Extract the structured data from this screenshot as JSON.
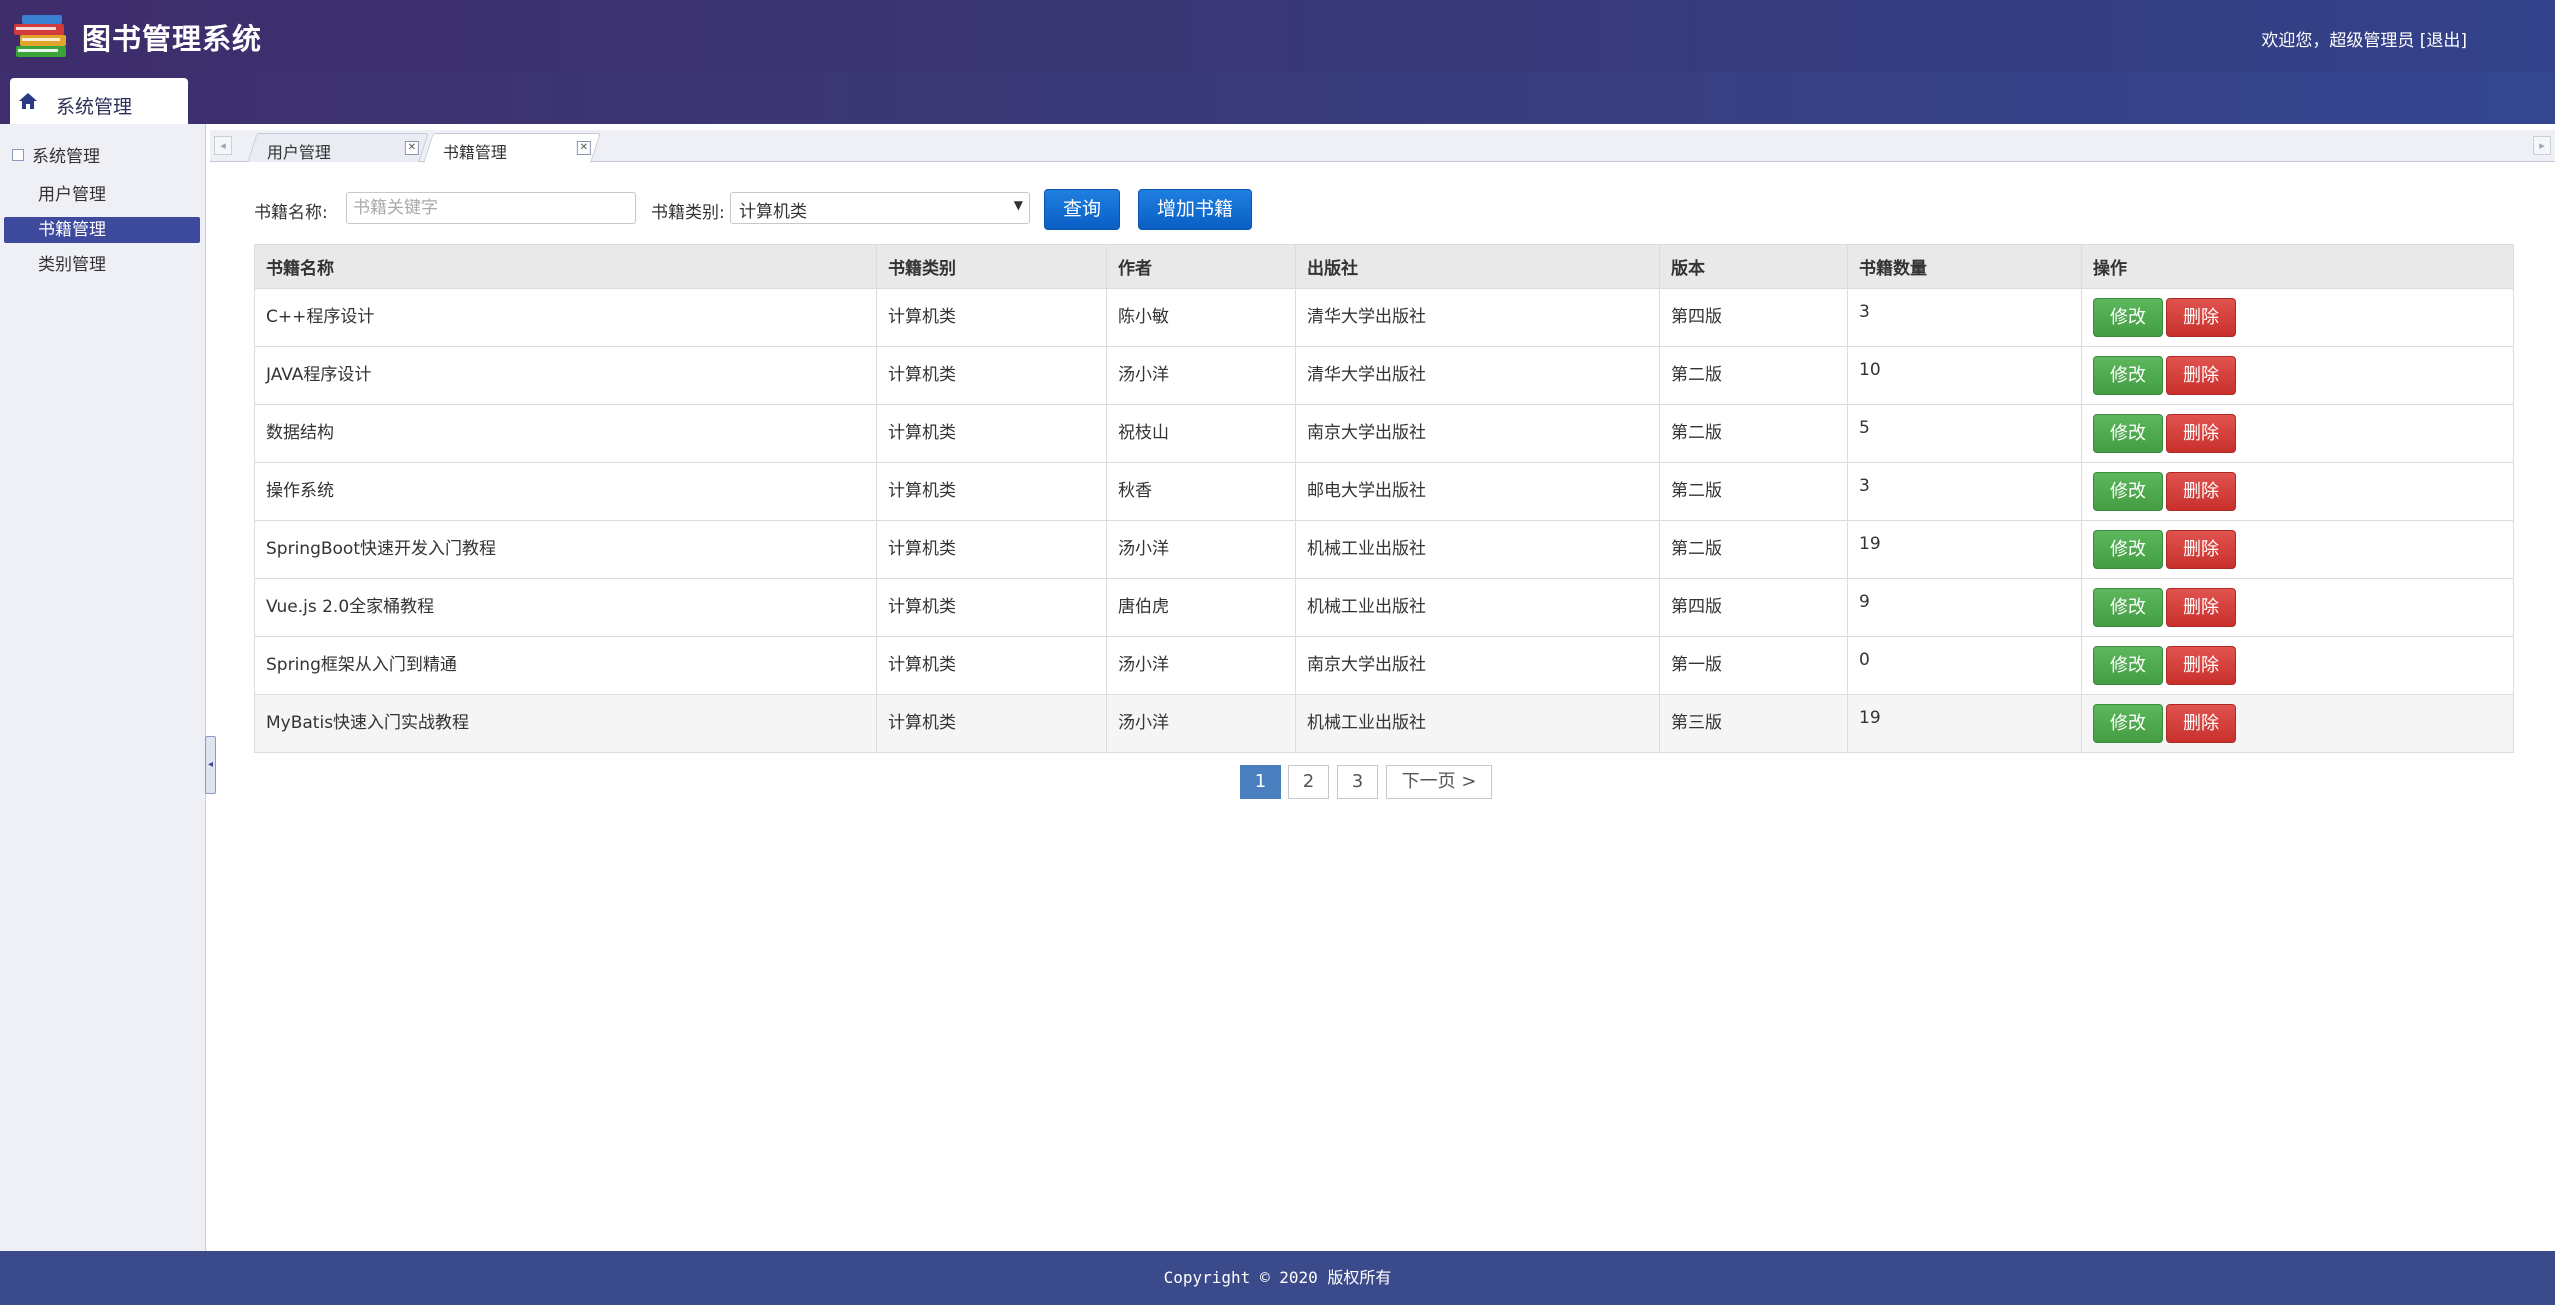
{
  "header": {
    "app_title": "图书管理系统",
    "welcome_text": "欢迎您，超级管理员",
    "logout_label": "[退出]"
  },
  "menu": {
    "top_tab_label": "系统管理"
  },
  "sidebar": {
    "group_label": "系统管理",
    "items": [
      {
        "label": "用户管理",
        "active": false
      },
      {
        "label": "书籍管理",
        "active": true
      },
      {
        "label": "类别管理",
        "active": false
      }
    ]
  },
  "tabs": [
    {
      "label": "用户管理",
      "active": false
    },
    {
      "label": "书籍管理",
      "active": true
    }
  ],
  "search": {
    "name_label": "书籍名称:",
    "name_placeholder": "书籍关键字",
    "category_label": "书籍类别:",
    "category_value": "计算机类",
    "query_button": "查询",
    "add_button": "增加书籍"
  },
  "table": {
    "headers": [
      "书籍名称",
      "书籍类别",
      "作者",
      "出版社",
      "版本",
      "书籍数量",
      "操作"
    ],
    "edit_label": "修改",
    "delete_label": "删除",
    "rows": [
      {
        "name": "C++程序设计",
        "category": "计算机类",
        "author": "陈小敏",
        "publisher": "清华大学出版社",
        "edition": "第四版",
        "count": "3"
      },
      {
        "name": "JAVA程序设计",
        "category": "计算机类",
        "author": "汤小洋",
        "publisher": "清华大学出版社",
        "edition": "第二版",
        "count": "10"
      },
      {
        "name": "数据结构",
        "category": "计算机类",
        "author": "祝枝山",
        "publisher": "南京大学出版社",
        "edition": "第二版",
        "count": "5"
      },
      {
        "name": "操作系统",
        "category": "计算机类",
        "author": "秋香",
        "publisher": "邮电大学出版社",
        "edition": "第二版",
        "count": "3"
      },
      {
        "name": "SpringBoot快速开发入门教程",
        "category": "计算机类",
        "author": "汤小洋",
        "publisher": "机械工业出版社",
        "edition": "第二版",
        "count": "19"
      },
      {
        "name": "Vue.js 2.0全家桶教程",
        "category": "计算机类",
        "author": "唐伯虎",
        "publisher": "机械工业出版社",
        "edition": "第四版",
        "count": "9"
      },
      {
        "name": "Spring框架从入门到精通",
        "category": "计算机类",
        "author": "汤小洋",
        "publisher": "南京大学出版社",
        "edition": "第一版",
        "count": "0"
      },
      {
        "name": "MyBatis快速入门实战教程",
        "category": "计算机类",
        "author": "汤小洋",
        "publisher": "机械工业出版社",
        "edition": "第三版",
        "count": "19"
      }
    ]
  },
  "pagination": {
    "pages": [
      "1",
      "2",
      "3"
    ],
    "current": "1",
    "next_label": "下一页 >"
  },
  "footer": {
    "copyright": "Copyright © 2020 版权所有"
  },
  "colors": {
    "header_bg": "#3e2c6b",
    "sidebar_active": "#3d4a9e",
    "primary_button": "#0a5fc4",
    "edit_button": "#5cb85c",
    "delete_button": "#d9534f",
    "footer_bg": "#3b4a8a"
  },
  "icons": {
    "logo": "books-stack-icon",
    "home": "home-icon",
    "tree_node": "tree-node-icon",
    "close": "close-icon",
    "dropdown": "chevron-down-icon"
  }
}
